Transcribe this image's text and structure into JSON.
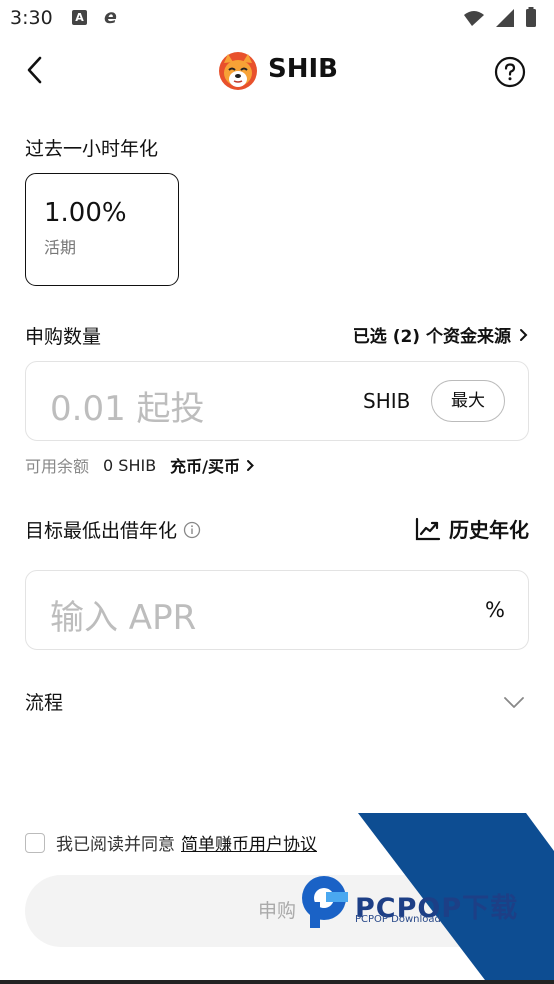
{
  "status_bar": {
    "time": "3:30",
    "left_icons": [
      "a-notification-icon",
      "edge-browser-icon"
    ],
    "right_icons": [
      "wifi-icon",
      "signal-icon",
      "battery-icon"
    ]
  },
  "header": {
    "coin_name": "SHIB",
    "logo_icon": "shiba-inu-logo"
  },
  "apy_section": {
    "label": "过去一小时年化",
    "value": "1.00%",
    "type": "活期"
  },
  "subscription": {
    "label": "申购数量",
    "source_link": "已选 (2) 个资金来源",
    "amount_placeholder": "0.01 起投",
    "unit": "SHIB",
    "max_label": "最大"
  },
  "balance": {
    "label": "可用余额",
    "value": "0 SHIB",
    "buy_link": "充币/买币"
  },
  "target_apr": {
    "label": "目标最低出借年化",
    "history_link": "历史年化",
    "placeholder": "输入 APR",
    "unit": "%"
  },
  "process": {
    "label": "流程"
  },
  "agreement": {
    "text": "我已阅读并同意",
    "link": "简单赚币用户协议",
    "checked": false
  },
  "submit": {
    "label": "申购"
  },
  "watermark": {
    "brand": "PCPOP下载",
    "sub": "PCPOP Download"
  },
  "colors": {
    "primary_text": "#111111",
    "muted_text": "#888888",
    "placeholder": "#bdbdbd",
    "border": "#e3e3e3",
    "button_disabled_bg": "#f3f3f3",
    "watermark_blue": "#0d4d92"
  }
}
